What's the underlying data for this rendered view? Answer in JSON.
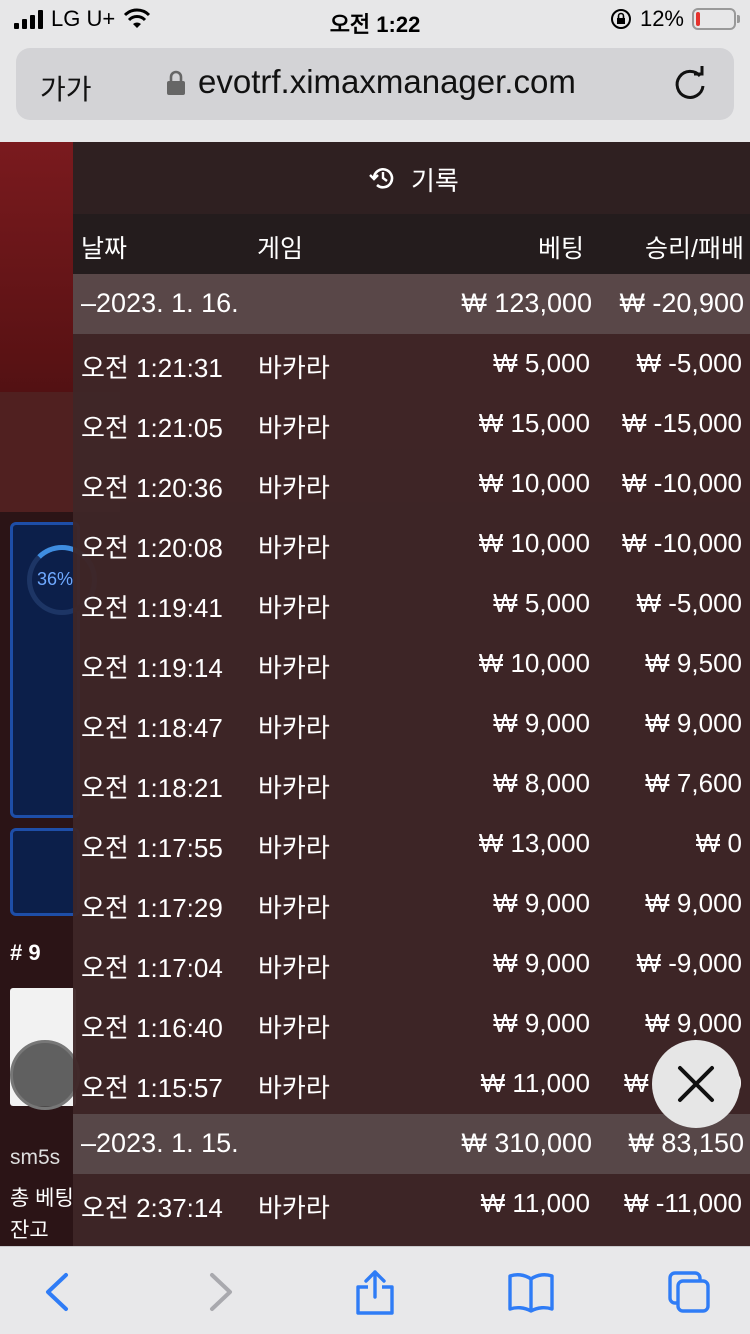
{
  "status_bar": {
    "carrier": "LG U+",
    "time": "오전 1:22",
    "battery": "12%",
    "battery_level": 0.12
  },
  "browser": {
    "text_size_label": "가가",
    "url": "evotrf.ximaxmanager.com",
    "icons": [
      "lock-icon",
      "reload-icon"
    ]
  },
  "background": {
    "progress_label": "36%",
    "progress_level": 0.36,
    "hash_label": "# 9",
    "user_label": "sm5s",
    "bet_label": "총 베팅",
    "balance_label": "잔고"
  },
  "history": {
    "title": "기록",
    "headers": {
      "date": "날짜",
      "game": "게임",
      "bet": "베팅",
      "result": "승리/패배"
    },
    "groups": [
      {
        "date": "–2023. 1. 16.",
        "bet_total": "₩ 123,000",
        "result_total": "₩ -20,900",
        "entries": [
          {
            "time": "오전 1:21:31",
            "game": "바카라",
            "bet": "₩ 5,000",
            "result": "₩ -5,000"
          },
          {
            "time": "오전 1:21:05",
            "game": "바카라",
            "bet": "₩ 15,000",
            "result": "₩ -15,000"
          },
          {
            "time": "오전 1:20:36",
            "game": "바카라",
            "bet": "₩ 10,000",
            "result": "₩ -10,000"
          },
          {
            "time": "오전 1:20:08",
            "game": "바카라",
            "bet": "₩ 10,000",
            "result": "₩ -10,000"
          },
          {
            "time": "오전 1:19:41",
            "game": "바카라",
            "bet": "₩ 5,000",
            "result": "₩ -5,000"
          },
          {
            "time": "오전 1:19:14",
            "game": "바카라",
            "bet": "₩ 10,000",
            "result": "₩ 9,500"
          },
          {
            "time": "오전 1:18:47",
            "game": "바카라",
            "bet": "₩ 9,000",
            "result": "₩ 9,000"
          },
          {
            "time": "오전 1:18:21",
            "game": "바카라",
            "bet": "₩ 8,000",
            "result": "₩ 7,600"
          },
          {
            "time": "오전 1:17:55",
            "game": "바카라",
            "bet": "₩ 13,000",
            "result": "₩ 0"
          },
          {
            "time": "오전 1:17:29",
            "game": "바카라",
            "bet": "₩ 9,000",
            "result": "₩ 9,000"
          },
          {
            "time": "오전 1:17:04",
            "game": "바카라",
            "bet": "₩ 9,000",
            "result": "₩ -9,000"
          },
          {
            "time": "오전 1:16:40",
            "game": "바카라",
            "bet": "₩ 9,000",
            "result": "₩ 9,000"
          },
          {
            "time": "오전 1:15:57",
            "game": "바카라",
            "bet": "₩ 11,000",
            "result": "₩ -11,000"
          }
        ]
      },
      {
        "date": "–2023. 1. 15.",
        "bet_total": "₩ 310,000",
        "result_total": "₩ 83,150",
        "entries": [
          {
            "time": "오전 2:37:14",
            "game": "바카라",
            "bet": "₩ 11,000",
            "result": "₩ -11,000"
          }
        ]
      }
    ]
  },
  "toolbar": {
    "icons": [
      "back-icon",
      "forward-icon",
      "share-icon",
      "bookmarks-icon",
      "tabs-icon"
    ]
  },
  "colors": {
    "ios_blue": "#2f7cf6",
    "battery_red": "#e5322d",
    "panel_bg": "#3e2628"
  }
}
